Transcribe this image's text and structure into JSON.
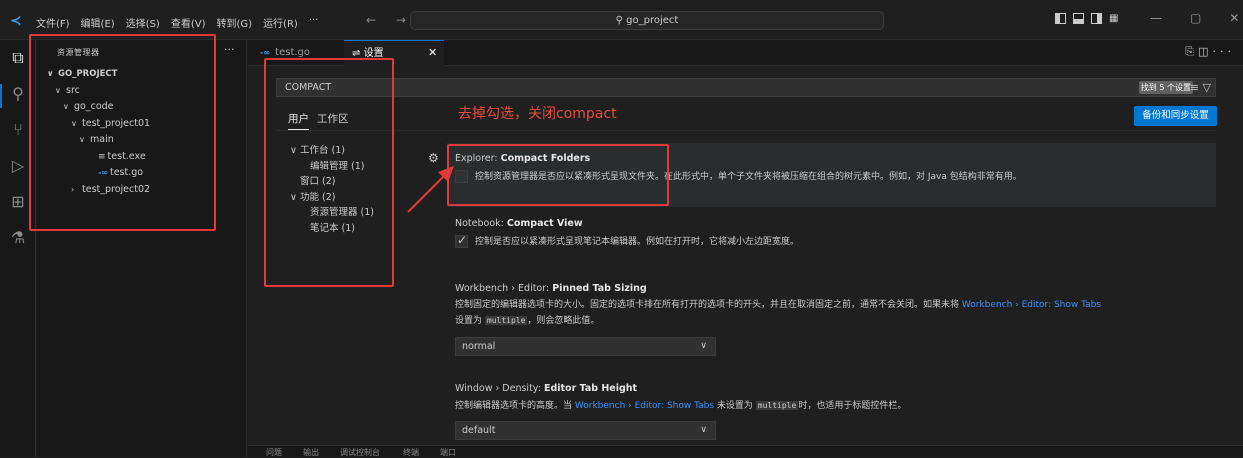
{
  "titlebar": {
    "menu": [
      "文件(F)",
      "编辑(E)",
      "选择(S)",
      "查看(V)",
      "转到(G)",
      "运行(R)",
      "···"
    ],
    "nav": "← →",
    "command_center": "⚲ go_project",
    "window_controls": [
      "—",
      "▢",
      "✕"
    ]
  },
  "explorer": {
    "title": "资源管理器",
    "more": "···",
    "tree": [
      {
        "label": "GO_PROJECT",
        "chevron": "∨",
        "indent": 0,
        "kind": "root"
      },
      {
        "label": "src",
        "chevron": "∨",
        "indent": 1,
        "kind": "folder"
      },
      {
        "label": "go_code",
        "chevron": "∨",
        "indent": 2,
        "kind": "folder"
      },
      {
        "label": "test_project01",
        "chevron": "∨",
        "indent": 3,
        "kind": "folder"
      },
      {
        "label": "main",
        "chevron": "∨",
        "indent": 4,
        "kind": "folder"
      },
      {
        "label": "test.exe",
        "chevron": "",
        "indent": 5,
        "kind": "exe"
      },
      {
        "label": "test.go",
        "chevron": "",
        "indent": 5,
        "kind": "go"
      },
      {
        "label": "test_project02",
        "chevron": "›",
        "indent": 3,
        "kind": "folder"
      }
    ]
  },
  "tabs": [
    {
      "label": "test.go",
      "icon": "-∞",
      "active": false
    },
    {
      "label": "设置",
      "icon": "⇌",
      "active": true
    }
  ],
  "settings": {
    "search_value": "COMPACT",
    "results_badge": "找到 5 个设置",
    "scopes": [
      "用户",
      "工作区"
    ],
    "sync_button": "备份和同步设置",
    "toc": [
      {
        "label": "∨ 工作台 (1)",
        "indent": 0
      },
      {
        "label": "编辑管理 (1)",
        "indent": 2
      },
      {
        "label": "窗口 (2)",
        "indent": 1
      },
      {
        "label": "∨ 功能 (2)",
        "indent": 0
      },
      {
        "label": "资源管理器 (1)",
        "indent": 2
      },
      {
        "label": "笔记本 (1)",
        "indent": 2
      }
    ],
    "items": [
      {
        "prefix": "Explorer: ",
        "name": "Compact Folders",
        "kind": "checkbox",
        "checked": false,
        "desc": "控制资源管理器是否应以紧凑形式呈现文件夹。在此形式中，单个子文件夹将被压缩在组合的树元素中。例如，对 Java 包结构非常有用。"
      },
      {
        "prefix": "Notebook: ",
        "name": "Compact View",
        "kind": "checkbox",
        "checked": true,
        "desc": "控制是否应以紧凑形式呈现笔记本编辑器。例如在打开时，它将减小左边距宽度。"
      },
      {
        "prefix": "Workbench › Editor: ",
        "name": "Pinned Tab Sizing",
        "kind": "select",
        "desc1": "控制固定的编辑器选项卡的大小。固定的选项卡排在所有打开的选项卡的开头，并且在取消固定之前，通常不会关闭。如果未将 ",
        "link1": "Workbench › Editor: Show Tabs",
        "desc2_pre": "设置为 ",
        "code": "multiple",
        "desc2_post": "，则会忽略此值。",
        "value": "normal"
      },
      {
        "prefix": "Window › Density: ",
        "name": "Editor Tab Height",
        "kind": "select",
        "desc_pre": "控制编辑器选项卡的高度。当 ",
        "link": "Workbench › Editor: Show Tabs",
        "desc_mid": " 未设置为 ",
        "code": "multiple",
        "desc_post": "时，也适用于标题控件栏。",
        "value": "default"
      }
    ]
  },
  "annotation": {
    "text": "去掉勾选，关闭compact",
    "color": "#e74c3c"
  },
  "panel_tabs": [
    "问题",
    "输出",
    "调试控制台",
    "终端",
    "端口"
  ],
  "colors": {
    "accent": "#0078d4",
    "link": "#3794ff",
    "annotation_red": "#e03a3a"
  }
}
